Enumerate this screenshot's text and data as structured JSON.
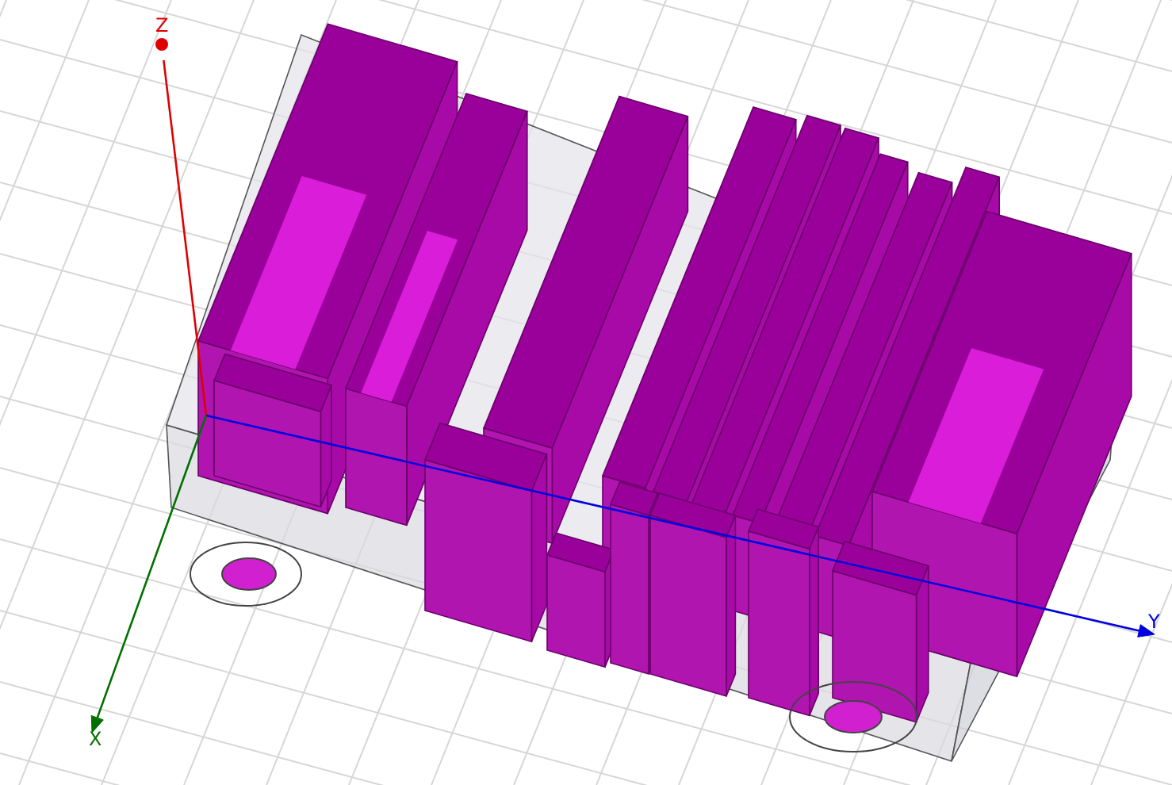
{
  "axes": [
    {
      "kind": "z",
      "label": "Z",
      "color": "#e00000"
    },
    {
      "kind": "y",
      "label": "Y",
      "color": "#0000e0"
    },
    {
      "kind": "x",
      "label": "X",
      "color": "#007000"
    }
  ]
}
